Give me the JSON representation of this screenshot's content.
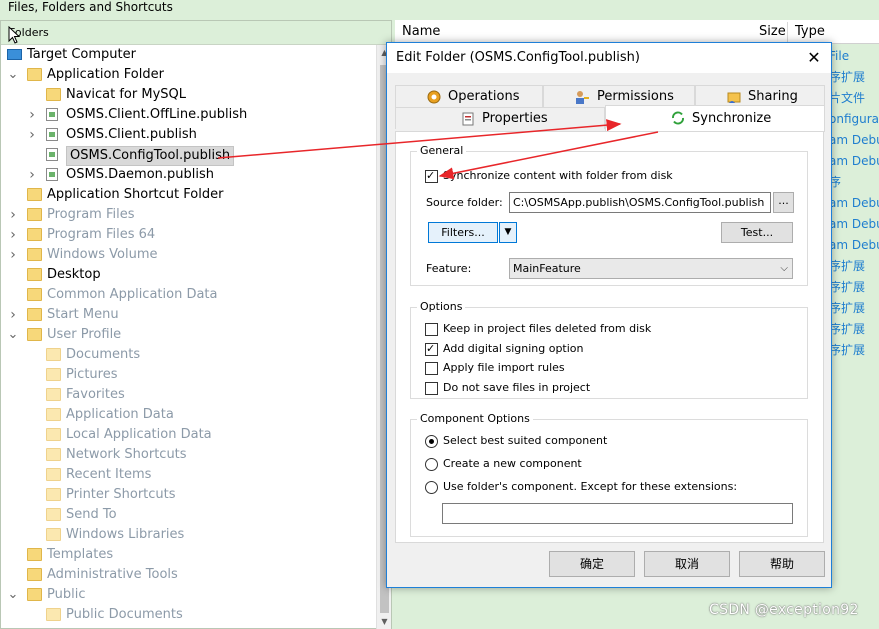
{
  "window": {
    "title": "Files, Folders and Shortcuts"
  },
  "folders_pane": {
    "header": "Folders",
    "tree": [
      {
        "label": "Target Computer",
        "icon": "monitor-icon",
        "level": 0,
        "expanded": null,
        "dim": false
      },
      {
        "label": "Application Folder",
        "icon": "folder-icon",
        "level": 0,
        "expanded": true,
        "dim": false
      },
      {
        "label": "Navicat for MySQL",
        "icon": "folder-icon",
        "level": 1,
        "expanded": null,
        "dim": false
      },
      {
        "label": "OSMS.Client.OffLine.publish",
        "icon": "file-icon",
        "level": 1,
        "expanded": false,
        "dim": false
      },
      {
        "label": "OSMS.Client.publish",
        "icon": "file-icon",
        "level": 1,
        "expanded": false,
        "dim": false
      },
      {
        "label": "OSMS.ConfigTool.publish",
        "icon": "file-icon",
        "level": 1,
        "expanded": null,
        "dim": false,
        "selected": true
      },
      {
        "label": "OSMS.Daemon.publish",
        "icon": "file-icon",
        "level": 1,
        "expanded": false,
        "dim": false
      },
      {
        "label": "Application Shortcut Folder",
        "icon": "folder-icon",
        "level": 0,
        "expanded": null,
        "dim": false
      },
      {
        "label": "Program Files",
        "icon": "folder-icon",
        "level": 0,
        "expanded": false,
        "dim": true
      },
      {
        "label": "Program Files 64",
        "icon": "folder-icon",
        "level": 0,
        "expanded": false,
        "dim": true
      },
      {
        "label": "Windows Volume",
        "icon": "folder-icon",
        "level": 0,
        "expanded": false,
        "dim": true
      },
      {
        "label": "Desktop",
        "icon": "folder-icon",
        "level": 0,
        "expanded": null,
        "dim": false
      },
      {
        "label": "Common Application Data",
        "icon": "folder-icon",
        "level": 0,
        "expanded": null,
        "dim": true
      },
      {
        "label": "Start Menu",
        "icon": "folder-icon",
        "level": 0,
        "expanded": false,
        "dim": true
      },
      {
        "label": "User Profile",
        "icon": "folder-icon",
        "level": 0,
        "expanded": true,
        "dim": true
      },
      {
        "label": "Documents",
        "icon": "folder-icon",
        "level": 1,
        "expanded": null,
        "dim": true
      },
      {
        "label": "Pictures",
        "icon": "folder-icon",
        "level": 1,
        "expanded": null,
        "dim": true
      },
      {
        "label": "Favorites",
        "icon": "folder-icon",
        "level": 1,
        "expanded": null,
        "dim": true
      },
      {
        "label": "Application Data",
        "icon": "folder-icon",
        "level": 1,
        "expanded": null,
        "dim": true
      },
      {
        "label": "Local Application Data",
        "icon": "folder-icon",
        "level": 1,
        "expanded": null,
        "dim": true
      },
      {
        "label": "Network Shortcuts",
        "icon": "folder-icon",
        "level": 1,
        "expanded": null,
        "dim": true
      },
      {
        "label": "Recent Items",
        "icon": "folder-icon",
        "level": 1,
        "expanded": null,
        "dim": true
      },
      {
        "label": "Printer Shortcuts",
        "icon": "folder-icon",
        "level": 1,
        "expanded": null,
        "dim": true
      },
      {
        "label": "Send To",
        "icon": "folder-icon",
        "level": 1,
        "expanded": null,
        "dim": true
      },
      {
        "label": "Windows Libraries",
        "icon": "folder-icon",
        "level": 1,
        "expanded": null,
        "dim": true
      },
      {
        "label": "Templates",
        "icon": "folder-icon",
        "level": 0,
        "expanded": null,
        "dim": true
      },
      {
        "label": "Administrative Tools",
        "icon": "folder-icon",
        "level": 0,
        "expanded": null,
        "dim": true
      },
      {
        "label": "Public",
        "icon": "folder-icon",
        "level": 0,
        "expanded": true,
        "dim": true
      },
      {
        "label": "Public Documents",
        "icon": "folder-icon",
        "level": 1,
        "expanded": null,
        "dim": true
      }
    ]
  },
  "list_pane": {
    "columns": {
      "name": "Name",
      "size": "Size",
      "type": "Type"
    },
    "type_cells": [
      "File",
      "序扩展",
      "片文件",
      "onfigura",
      "am Debu",
      "am Debu",
      "序",
      "am Debu",
      "am Debu",
      "am Debu",
      "序扩展",
      "序扩展",
      "序扩展",
      "序扩展",
      "序扩展"
    ]
  },
  "dialog": {
    "title": "Edit Folder (OSMS.ConfigTool.publish)",
    "tabs": {
      "operations": "Operations",
      "permissions": "Permissions",
      "sharing": "Sharing",
      "properties": "Properties",
      "synchronize": "Synchronize"
    },
    "general": {
      "title": "General",
      "sync_label": "Synchronize content with folder from disk",
      "sync_checked": true,
      "source_label": "Source folder:",
      "source_value": "C:\\OSMSApp.publish\\OSMS.ConfigTool.publish",
      "browse_label": "...",
      "filters_label": "Filters...",
      "test_label": "Test...",
      "feature_label": "Feature:",
      "feature_value": "MainFeature"
    },
    "options": {
      "title": "Options",
      "items": [
        {
          "label": "Keep in project files deleted from disk",
          "checked": false
        },
        {
          "label": "Add digital signing option",
          "checked": true
        },
        {
          "label": "Apply file import rules",
          "checked": false
        },
        {
          "label": "Do not save files in project",
          "checked": false
        }
      ]
    },
    "component_options": {
      "title": "Component Options",
      "items": [
        {
          "label": "Select best suited component",
          "checked": true
        },
        {
          "label": "Create  a new component",
          "checked": false
        },
        {
          "label": "Use folder's component. Except for these extensions:",
          "checked": false
        }
      ],
      "extensions_value": ""
    },
    "buttons": {
      "ok": "确定",
      "cancel": "取消",
      "help": "帮助"
    }
  },
  "watermark": "CSDN @exception92",
  "colors": {
    "background": "#dcefd9",
    "accent": "#1e7fd8",
    "annotation_arrow": "#e8262a",
    "dim_text": "#8c9aa8",
    "link_text": "#1f7ecf"
  }
}
